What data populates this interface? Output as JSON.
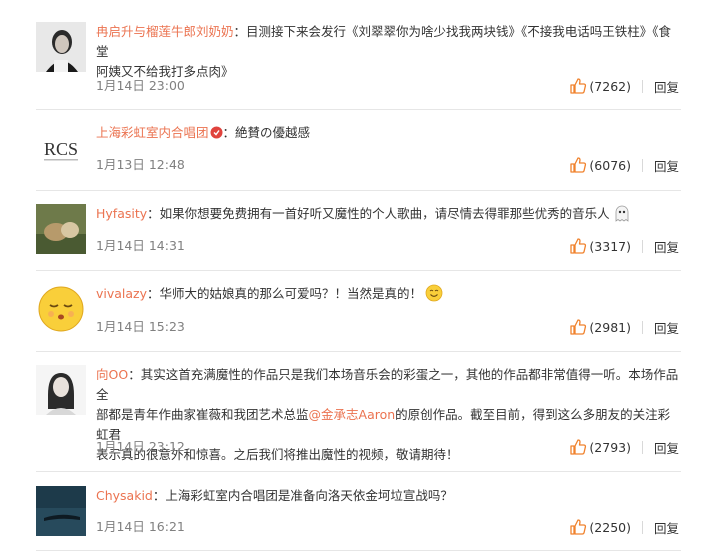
{
  "comments": [
    {
      "username": "冉启升与榴莲牛郎刘奶奶",
      "separator": "：",
      "text_lines": [
        "目测接下来会发行《刘翠翠你为啥少找我两块钱》《不接我电话吗王铁柱》《食堂",
        "阿姨又不给我打多点肉》"
      ],
      "time": "1月14日 23:00",
      "likes": "(7262)",
      "reply": "回复"
    },
    {
      "username": "上海彩虹室内合唱团",
      "separator": "：",
      "text_lines": [
        "絶賛の優越感"
      ],
      "time": "1月13日 12:48",
      "likes": "(6076)",
      "reply": "回复",
      "logo_text": "RCS"
    },
    {
      "username": "Hyfasity",
      "separator": "：",
      "text_lines": [
        "如果你想要免费拥有一首好听又魔性的个人歌曲，请尽情去得罪那些优秀的音乐人"
      ],
      "time": "1月14日 14:31",
      "likes": "(3317)",
      "reply": "回复"
    },
    {
      "username": "vivalazy",
      "separator": "：",
      "text_lines": [
        "华师大的姑娘真的那么可爱吗？！当然是真的！"
      ],
      "time": "1月14日 15:23",
      "likes": "(2981)",
      "reply": "回复"
    },
    {
      "username": "向OO",
      "separator": "：",
      "text_lines": [
        "其实这首充满魔性的作品只是我们本场音乐会的彩蛋之一，其他的作品都非常值得一听。本场作品全",
        "部都是青年作曲家崔薇和我团艺术总监",
        "的原创作品。截至目前，得到这么多朋友的关注彩虹君",
        "表示真的很意外和惊喜。之后我们将推出魔性的视频，敬请期待！"
      ],
      "mention": "@金承志Aaron",
      "time": "1月14日 23:12",
      "likes": "(2793)",
      "reply": "回复"
    },
    {
      "username": "Chysakid",
      "separator": "：",
      "text_lines": [
        "上海彩虹室内合唱团是准备向洛天依金坷垃宣战吗？"
      ],
      "time": "1月14日 16:21",
      "likes": "(2250)",
      "reply": "回复"
    }
  ],
  "colors": {
    "username": "#eb7350",
    "text": "#333333",
    "meta": "#808080",
    "divider": "#e6e6e6"
  },
  "icons": {
    "like": "thumbs-up-icon",
    "verified": "verified-badge-icon",
    "emoji_ghost": "ghost-emoji-icon",
    "emoji_smile": "smile-emoji-icon"
  }
}
